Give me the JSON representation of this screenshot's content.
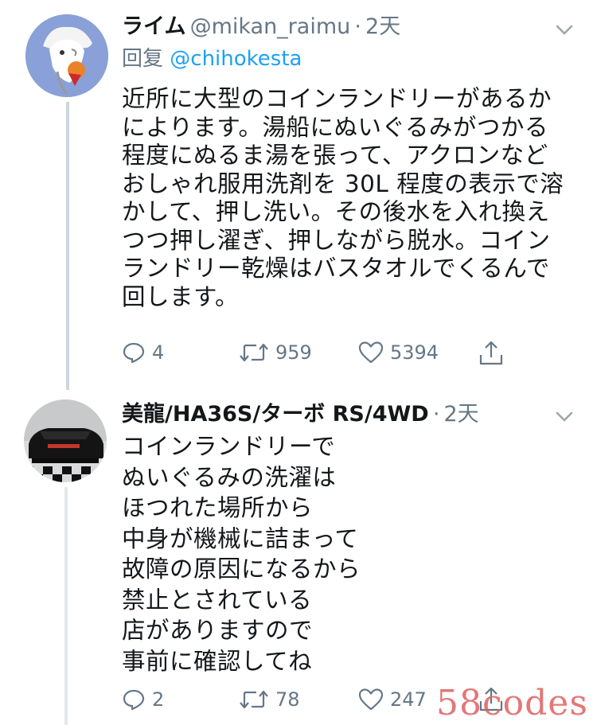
{
  "tweets": [
    {
      "display_name": "ライム",
      "handle": "@mikan_raimu",
      "separator": "·",
      "time": "2天",
      "reply_label": "回复",
      "reply_handle": "@chihokesta",
      "text_lines": [
        "近所に大型のコインランドリーがあるか",
        "によります。湯船にぬいぐるみがつかる",
        "程度にぬるま湯を張って、アクロンなど",
        "おしゃれ服用洗剤を 30L 程度の表示で溶",
        "かして、押し洗い。その後水を入れ換え",
        "つつ押し濯ぎ、押しながら脱水。コイン",
        "ランドリー乾燥はバスタオルでくるんで",
        "回します。"
      ],
      "replies": "4",
      "retweets": "959",
      "likes": "5394"
    },
    {
      "display_name": "美龍/HA36S/ターボ RS/4WD",
      "separator": "·",
      "time": "2天",
      "text_lines": [
        "コインランドリーで",
        "ぬいぐるみの洗濯は",
        "ほつれた場所から",
        "中身が機械に詰まって",
        "故障の原因になるから",
        "禁止とされている",
        "店がありますので",
        "事前に確認してね"
      ],
      "replies": "2",
      "retweets": "78",
      "likes": "247"
    }
  ],
  "watermark": "58codes",
  "colors": {
    "text": "#14171a",
    "secondary": "#657786",
    "link": "#1da1f2",
    "thread_line": "#ccd6dd"
  },
  "icons": [
    "reply-icon",
    "retweet-icon",
    "like-icon",
    "share-icon",
    "chevron-down-icon"
  ]
}
